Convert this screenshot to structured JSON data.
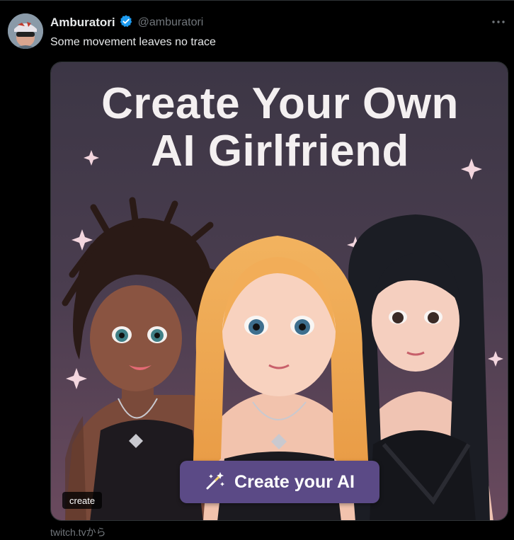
{
  "tweet": {
    "display_name": "Amburatori",
    "handle": "@amburatori",
    "verified": true,
    "text": "Some movement leaves no trace"
  },
  "card": {
    "headline_line1": "Create Your Own",
    "headline_line2": "AI Girlfriend",
    "cta_label": "Create your AI",
    "domain_badge": "create",
    "source": "twitch.tvから"
  },
  "icons": {
    "verified": "verified-badge-icon",
    "more": "more-options-icon",
    "cta": "magic-wand-icon"
  },
  "colors": {
    "background": "#000000",
    "text_primary": "#e7e9ea",
    "text_secondary": "#71767b",
    "verified_blue": "#1d9bf0",
    "cta_purple": "#5b4a86"
  }
}
